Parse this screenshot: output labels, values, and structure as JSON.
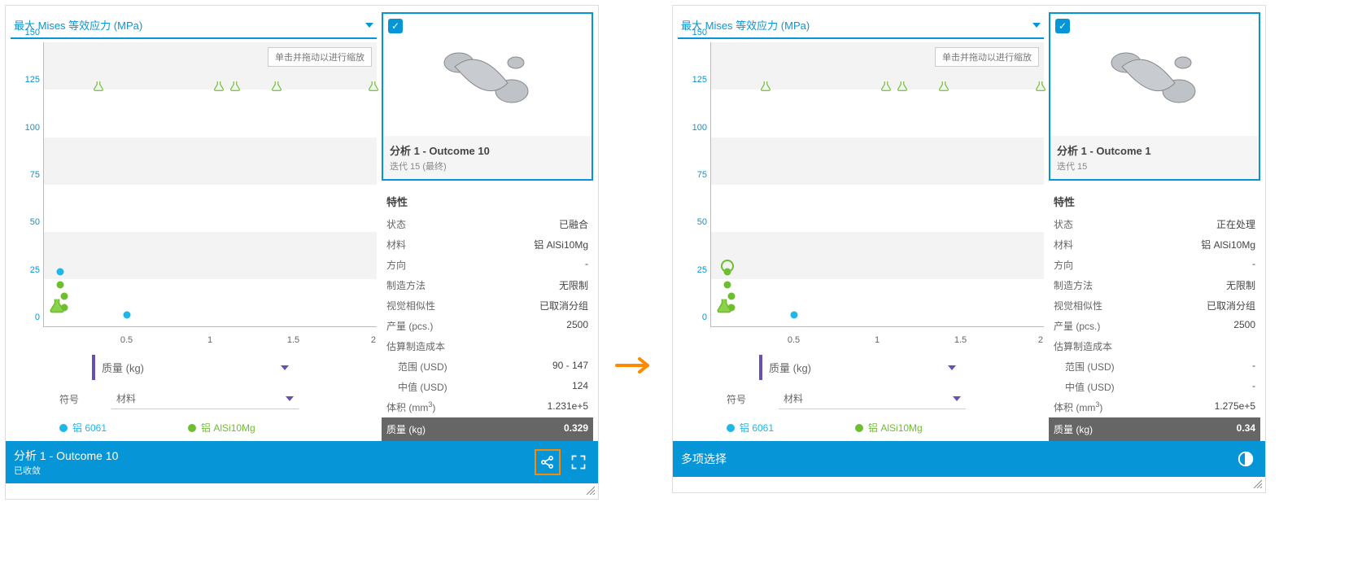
{
  "yaxis_dropdown": "最大 Mises 等效应力 (MPa)",
  "xaxis_dropdown": "质量 (kg)",
  "symbol_label": "符号",
  "symbol_dropdown": "材料",
  "zoom_hint": "单击并拖动以进行缩放",
  "legend": [
    {
      "label": "铝 6061",
      "color": "#1fb6e8"
    },
    {
      "label": "铝 AlSi10Mg",
      "color": "#6ebe2f"
    }
  ],
  "left": {
    "preview_title": "分析 1 - Outcome 10",
    "preview_sub": "迭代 15 (最终)",
    "status_label": "特性",
    "rows": {
      "status_k": "状态",
      "status_v": "已融合",
      "material_k": "材料",
      "material_v": "铝 AlSi10Mg",
      "orient_k": "方向",
      "orient_v": "-",
      "method_k": "制造方法",
      "method_v": "无限制",
      "visual_k": "视觉相似性",
      "visual_v": "已取消分组",
      "qty_k": "产量 (pcs.)",
      "qty_v": "2500",
      "cost_k": "估算制造成本",
      "range_k": "范围 (USD)",
      "range_v": "90 - 147",
      "median_k": "中值 (USD)",
      "median_v": "124",
      "vol_k": "体积 (mm",
      "vol_v": "1.231e+5",
      "mass_k": "质量 (kg)",
      "mass_v": "0.329"
    },
    "bar_title": "分析 1 - Outcome 10",
    "bar_sub": "已收敛"
  },
  "right": {
    "preview_title": "分析 1 - Outcome 1",
    "preview_sub": "迭代 15",
    "status_label": "特性",
    "rows": {
      "status_k": "状态",
      "status_v": "正在处理",
      "material_k": "材料",
      "material_v": "铝 AlSi10Mg",
      "orient_k": "方向",
      "orient_v": "-",
      "method_k": "制造方法",
      "method_v": "无限制",
      "visual_k": "视觉相似性",
      "visual_v": "已取消分组",
      "qty_k": "产量 (pcs.)",
      "qty_v": "2500",
      "cost_k": "估算制造成本",
      "range_k": "范围 (USD)",
      "range_v": "-",
      "median_k": "中值 (USD)",
      "median_v": "-",
      "vol_k": "体积 (mm",
      "vol_v": "1.275e+5",
      "mass_k": "质量 (kg)",
      "mass_v": "0.34"
    },
    "bar_title": "多项选择",
    "bar_sub": ""
  },
  "chart_data": {
    "type": "scatter",
    "xlabel": "质量 (kg)",
    "ylabel": "最大 Mises 等效应力 (MPa)",
    "xlim": [
      0,
      2
    ],
    "ylim": [
      0,
      150
    ],
    "xticks": [
      0.5,
      1,
      1.5,
      2
    ],
    "yticks": [
      0,
      25,
      50,
      75,
      100,
      125,
      150
    ],
    "series": [
      {
        "name": "铝 6061 dot",
        "symbol": "dot",
        "color": "#1fb6e8",
        "points": [
          {
            "x": 0.5,
            "y": 2
          }
        ]
      },
      {
        "name": "铝 AlSi10Mg flask",
        "symbol": "flask",
        "color": "#6ebe2f",
        "points": [
          {
            "x": 0.33,
            "y": 120
          },
          {
            "x": 1.05,
            "y": 120
          },
          {
            "x": 1.15,
            "y": 120
          },
          {
            "x": 1.4,
            "y": 120
          },
          {
            "x": 2.0,
            "y": 120
          },
          {
            "x": 0.1,
            "y": 25
          },
          {
            "x": 0.1,
            "y": 18
          },
          {
            "x": 0.12,
            "y": 12
          },
          {
            "x": 0.12,
            "y": 6
          }
        ]
      },
      {
        "name": "selected",
        "symbol": "flask-big",
        "color": "#6ebe2f",
        "points": [
          {
            "x": 0.08,
            "y": 1
          }
        ]
      }
    ],
    "right_extra_ring": {
      "x": 0.1,
      "y": 25
    }
  }
}
